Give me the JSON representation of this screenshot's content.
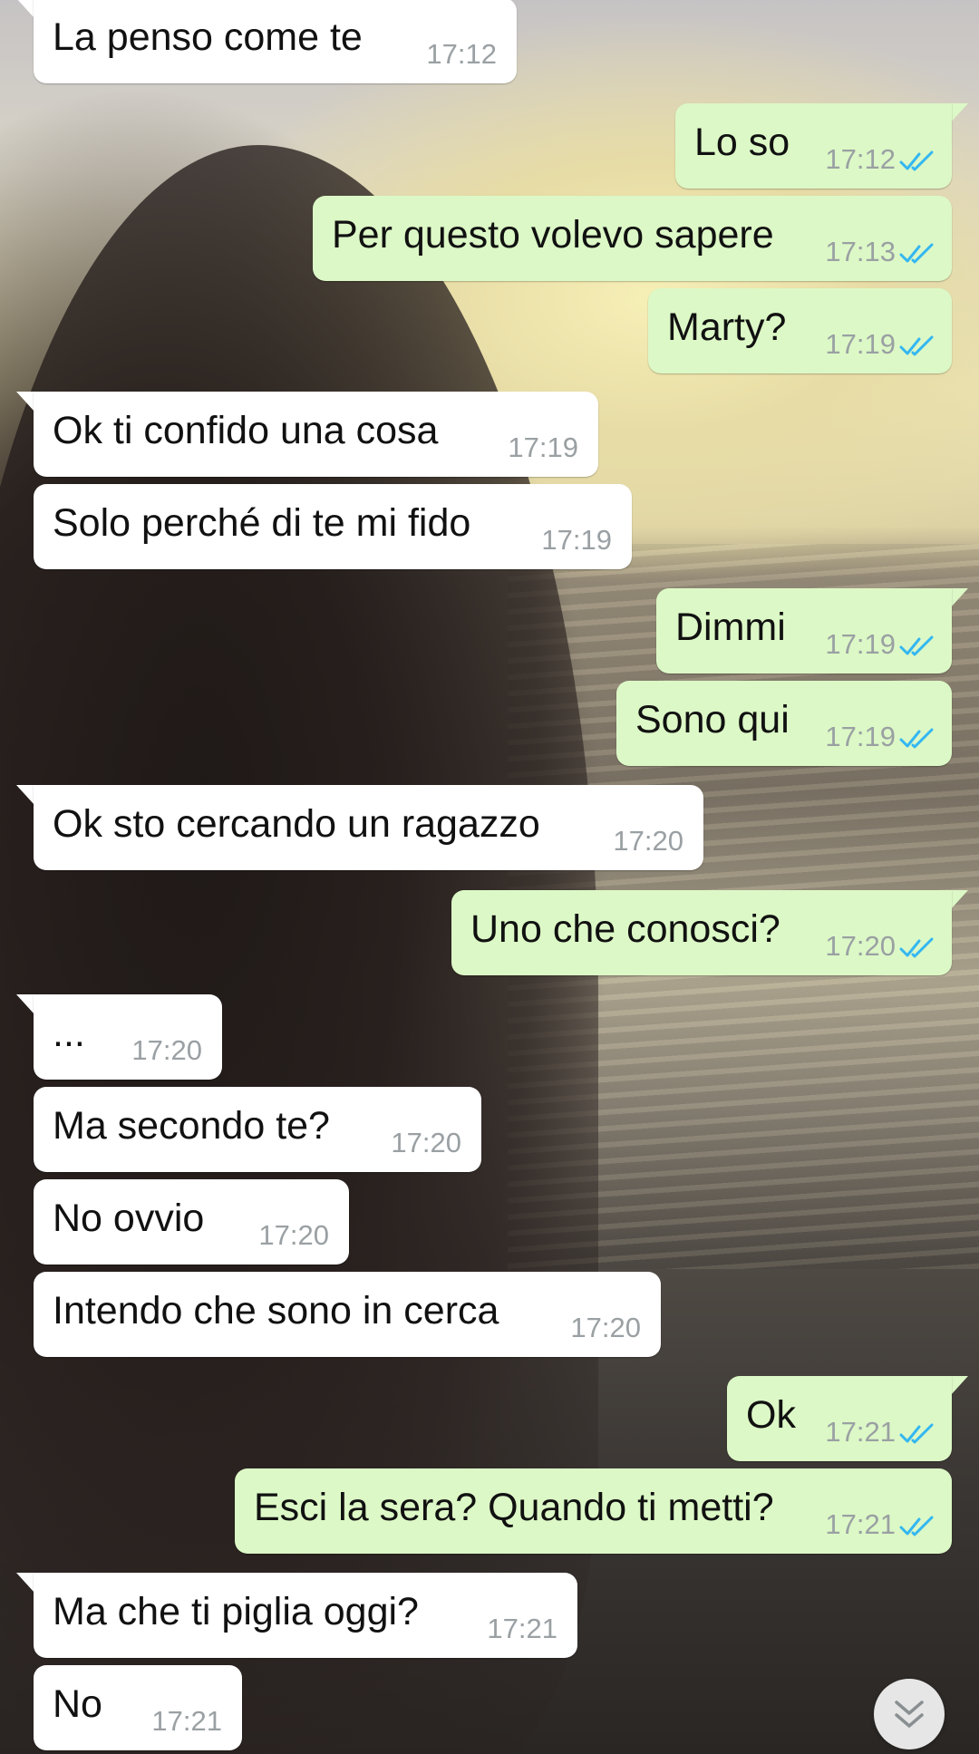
{
  "chat": {
    "messages": [
      {
        "id": 0,
        "direction": "incoming",
        "text": "La penso come te",
        "time": "17:12"
      },
      {
        "id": 1,
        "direction": "outgoing",
        "text": "Lo so",
        "time": "17:12",
        "status": "read"
      },
      {
        "id": 2,
        "direction": "outgoing",
        "text": "Per questo volevo sapere",
        "time": "17:13",
        "status": "read"
      },
      {
        "id": 3,
        "direction": "outgoing",
        "text": "Marty?",
        "time": "17:19",
        "status": "read"
      },
      {
        "id": 4,
        "direction": "incoming",
        "text": "Ok ti confido una cosa",
        "time": "17:19"
      },
      {
        "id": 5,
        "direction": "incoming",
        "text": "Solo perché di te mi fido",
        "time": "17:19"
      },
      {
        "id": 6,
        "direction": "outgoing",
        "text": "Dimmi",
        "time": "17:19",
        "status": "read"
      },
      {
        "id": 7,
        "direction": "outgoing",
        "text": "Sono qui",
        "time": "17:19",
        "status": "read"
      },
      {
        "id": 8,
        "direction": "incoming",
        "text": "Ok sto cercando un ragazzo",
        "time": "17:20"
      },
      {
        "id": 9,
        "direction": "outgoing",
        "text": "Uno che conosci?",
        "time": "17:20",
        "status": "read"
      },
      {
        "id": 10,
        "direction": "incoming",
        "text": "...",
        "time": "17:20"
      },
      {
        "id": 11,
        "direction": "incoming",
        "text": "Ma secondo te?",
        "time": "17:20"
      },
      {
        "id": 12,
        "direction": "incoming",
        "text": "No ovvio",
        "time": "17:20"
      },
      {
        "id": 13,
        "direction": "incoming",
        "text": "Intendo che sono in cerca",
        "time": "17:20"
      },
      {
        "id": 14,
        "direction": "outgoing",
        "text": "Ok",
        "time": "17:21",
        "status": "read"
      },
      {
        "id": 15,
        "direction": "outgoing",
        "text": "Esci la sera? Quando ti metti?",
        "time": "17:21",
        "status": "read"
      },
      {
        "id": 16,
        "direction": "incoming",
        "text": "Ma che ti piglia oggi?",
        "time": "17:21"
      },
      {
        "id": 17,
        "direction": "incoming",
        "text": "No",
        "time": "17:21"
      }
    ]
  },
  "icons": {
    "read_receipt": "double-check-icon",
    "scroll_down": "chevron-double-down-icon"
  },
  "colors": {
    "incoming_bubble": "#ffffff",
    "outgoing_bubble": "#dcf8c6",
    "read_ticks": "#34b7f1",
    "timestamp": "#9aa0a3"
  }
}
